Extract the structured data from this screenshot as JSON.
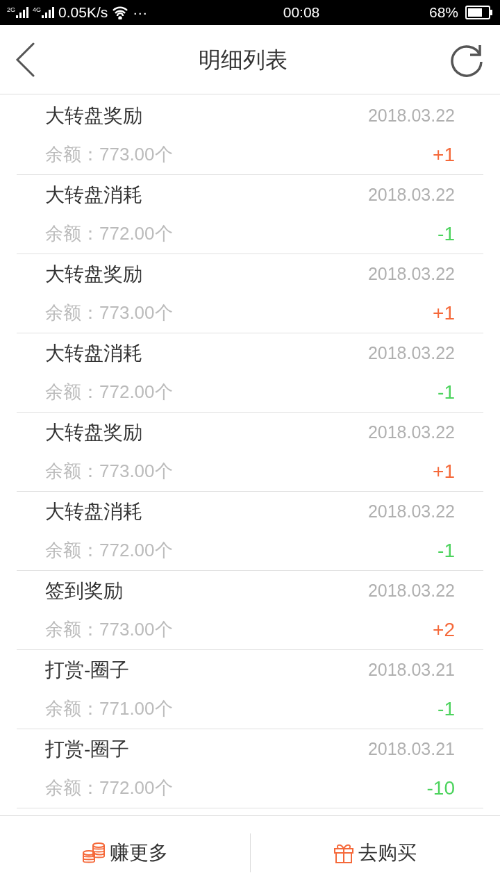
{
  "status_bar": {
    "network_1": "2G",
    "network_2": "4G",
    "speed": "0.05K/s",
    "more": "···",
    "time": "00:08",
    "battery": "68%"
  },
  "header": {
    "title": "明细列表"
  },
  "records": [
    {
      "title": "大转盘奖励",
      "date": "2018.03.22",
      "balance": "余额：773.00个",
      "amount": "+1",
      "kind": "gain"
    },
    {
      "title": "大转盘消耗",
      "date": "2018.03.22",
      "balance": "余额：772.00个",
      "amount": "-1",
      "kind": "loss"
    },
    {
      "title": "大转盘奖励",
      "date": "2018.03.22",
      "balance": "余额：773.00个",
      "amount": "+1",
      "kind": "gain"
    },
    {
      "title": "大转盘消耗",
      "date": "2018.03.22",
      "balance": "余额：772.00个",
      "amount": "-1",
      "kind": "loss"
    },
    {
      "title": "大转盘奖励",
      "date": "2018.03.22",
      "balance": "余额：773.00个",
      "amount": "+1",
      "kind": "gain"
    },
    {
      "title": "大转盘消耗",
      "date": "2018.03.22",
      "balance": "余额：772.00个",
      "amount": "-1",
      "kind": "loss"
    },
    {
      "title": "签到奖励",
      "date": "2018.03.22",
      "balance": "余额：773.00个",
      "amount": "+2",
      "kind": "gain"
    },
    {
      "title": "打赏-圈子",
      "date": "2018.03.21",
      "balance": "余额：771.00个",
      "amount": "-1",
      "kind": "loss"
    },
    {
      "title": "打赏-圈子",
      "date": "2018.03.21",
      "balance": "余额：772.00个",
      "amount": "-10",
      "kind": "loss"
    }
  ],
  "bottom_bar": [
    {
      "label": "赚更多",
      "kind": "coins"
    },
    {
      "label": "去购买",
      "kind": "gift"
    }
  ]
}
